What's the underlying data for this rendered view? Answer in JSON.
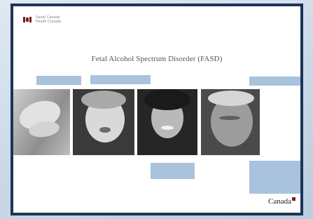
{
  "document": {
    "header": {
      "wordmark_line1": "Santé Canada",
      "wordmark_line2": "Health Canada"
    },
    "title": "Fetal Alcohol Spectrum Disorder (FASD)",
    "footer_wordmark": "Canada"
  },
  "colors": {
    "frame": "#1c3556",
    "accent_block": "#a9c3de",
    "flag_red": "#7a1f1f"
  },
  "photos": [
    {
      "name": "infant-feet-photo",
      "subject": "baby feet"
    },
    {
      "name": "child-photo",
      "subject": "young child"
    },
    {
      "name": "woman-photo",
      "subject": "smiling woman"
    },
    {
      "name": "elderly-man-photo",
      "subject": "older man"
    }
  ]
}
